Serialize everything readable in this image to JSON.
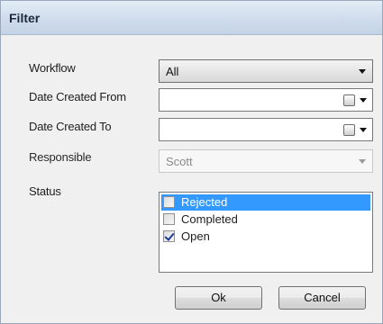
{
  "window": {
    "title": "Filter"
  },
  "form": {
    "workflow": {
      "label": "Workflow",
      "value": "All"
    },
    "date_created_from": {
      "label": "Date Created From",
      "value": ""
    },
    "date_created_to": {
      "label": "Date Created To",
      "value": ""
    },
    "responsible": {
      "label": "Responsible",
      "value": "Scott",
      "disabled": true
    },
    "status": {
      "label": "Status",
      "items": [
        {
          "label": "Rejected",
          "checked": false,
          "selected": true
        },
        {
          "label": "Completed",
          "checked": false,
          "selected": false
        },
        {
          "label": "Open",
          "checked": true,
          "selected": false
        }
      ]
    }
  },
  "buttons": {
    "ok_label": "Ok",
    "cancel_label": "Cancel"
  },
  "colors": {
    "selection": "#3399ff",
    "titlebar": "#cfdceb"
  }
}
